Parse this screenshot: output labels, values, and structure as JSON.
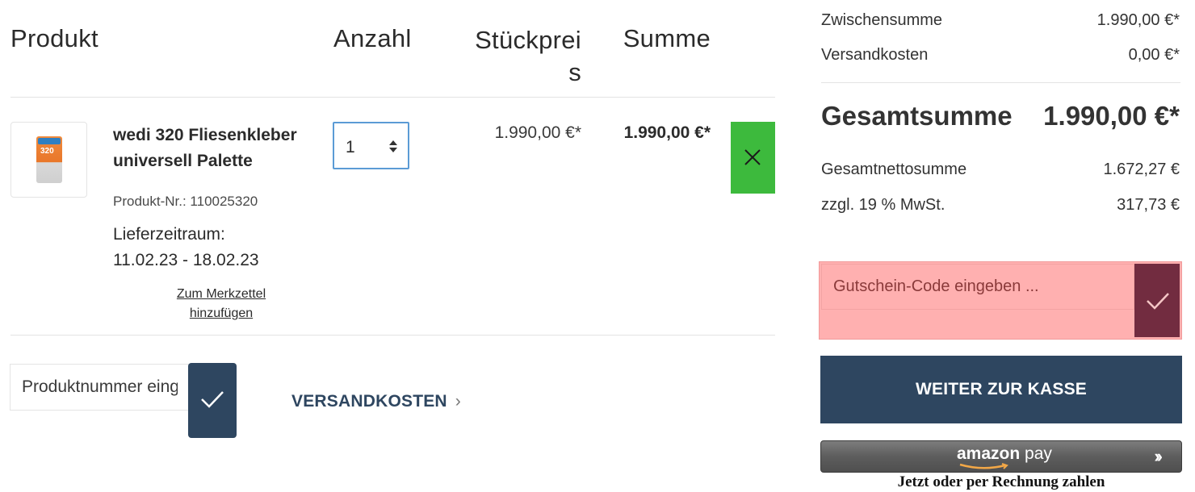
{
  "cart": {
    "headers": {
      "product": "Produkt",
      "quantity": "Anzahl",
      "unit_price_line1": "Stückprei",
      "unit_price_line2": "s",
      "total": "Summe"
    },
    "item": {
      "image_label": "320",
      "name_line1": "wedi 320 Fliesenkleber",
      "name_line2": "universell Palette",
      "product_number": "Produkt-Nr.: 110025320",
      "delivery_label": "Lieferzeitraum:",
      "delivery_range": "11.02.23 - 18.02.23",
      "wishlist_line1": "Zum Merkzettel",
      "wishlist_line2": "hinzufügen",
      "quantity": "1",
      "unit_price": "1.990,00 €*",
      "line_total": "1.990,00 €*"
    },
    "add_product": {
      "placeholder": "Produktnummer eingeben ..."
    },
    "shipping_link": "VERSANDKOSTEN",
    "colors": {
      "remove": "#3dba3d",
      "primary": "#2e4660"
    }
  },
  "summary": {
    "subtotal_label": "Zwischensumme",
    "subtotal_value": "1.990,00 €*",
    "shipping_label": "Versandkosten",
    "shipping_value": "0,00 €*",
    "grand_total_label": "Gesamtsumme",
    "grand_total_value": "1.990,00 €*",
    "net_label": "Gesamtnettosumme",
    "net_value": "1.672,27 €",
    "vat_label": "zzgl. 19 % MwSt.",
    "vat_value": "317,73 €",
    "coupon_placeholder": "Gutschein-Code eingeben ...",
    "checkout_label": "WEITER ZUR KASSE",
    "amazon_pay_brand": "amazon",
    "amazon_pay_word": "pay",
    "amazon_pay_caption": "Jetzt oder per Rechnung zahlen",
    "colors": {
      "coupon_bg": "#ffb0b0",
      "coupon_btn": "#722c40"
    }
  }
}
